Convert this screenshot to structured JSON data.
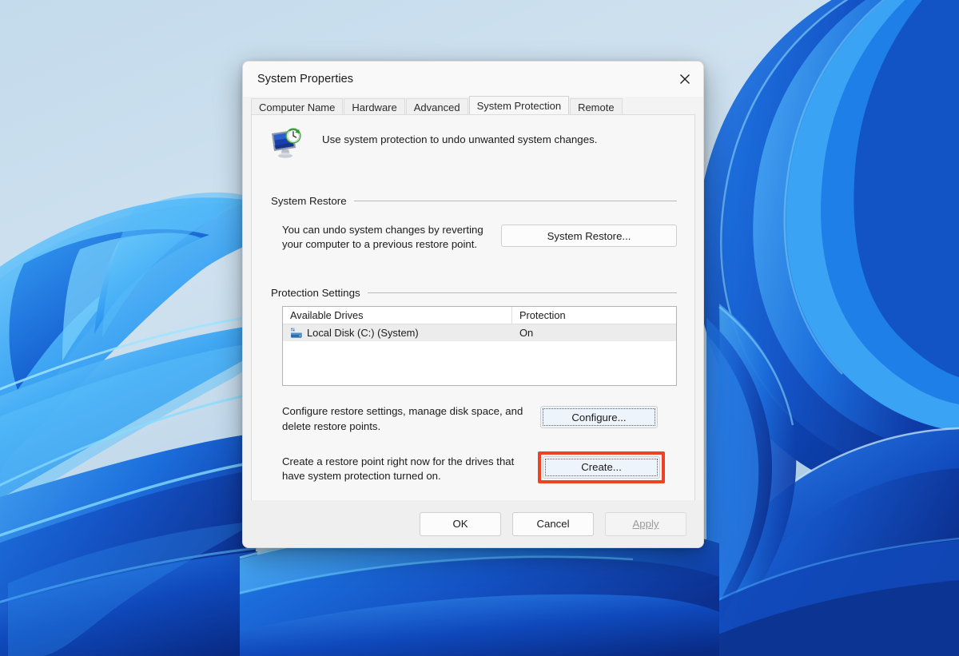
{
  "desktop": {
    "wallpaper_name": "windows-11-bloom-wallpaper",
    "colors": {
      "sky_light": "#cfe0ee",
      "sky_mid": "#bcd6e9",
      "ribbon_light": "#4fb3f5",
      "ribbon_mid": "#1e84e8",
      "ribbon_deep": "#1452c8",
      "ribbon_dark": "#0d3ca8",
      "ribbon_edge": "#79d4fb"
    }
  },
  "dialog": {
    "title": "System Properties",
    "close_label": "Close",
    "tabs": [
      {
        "label": "Computer Name",
        "active": false
      },
      {
        "label": "Hardware",
        "active": false
      },
      {
        "label": "Advanced",
        "active": false
      },
      {
        "label": "System Protection",
        "active": true
      },
      {
        "label": "Remote",
        "active": false
      }
    ],
    "header": {
      "icon": "system-protection-icon",
      "text": "Use system protection to undo unwanted system changes."
    },
    "system_restore": {
      "group_title": "System Restore",
      "description": "You can undo system changes by reverting your computer to a previous restore point.",
      "button_label": "System Restore..."
    },
    "protection_settings": {
      "group_title": "Protection Settings",
      "columns": [
        "Available Drives",
        "Protection"
      ],
      "rows": [
        {
          "icon": "hard-drive-icon",
          "drive": "Local Disk (C:) (System)",
          "protection": "On"
        }
      ],
      "configure": {
        "description": "Configure restore settings, manage disk space, and delete restore points.",
        "button_label": "Configure...",
        "focused": true
      },
      "create": {
        "description": "Create a restore point right now for the drives that have system protection turned on.",
        "button_label": "Create...",
        "focused": true,
        "highlight_color": "#ee4323"
      }
    },
    "footer": {
      "ok_label": "OK",
      "cancel_label": "Cancel",
      "apply_label": "Apply",
      "apply_disabled": true
    }
  }
}
